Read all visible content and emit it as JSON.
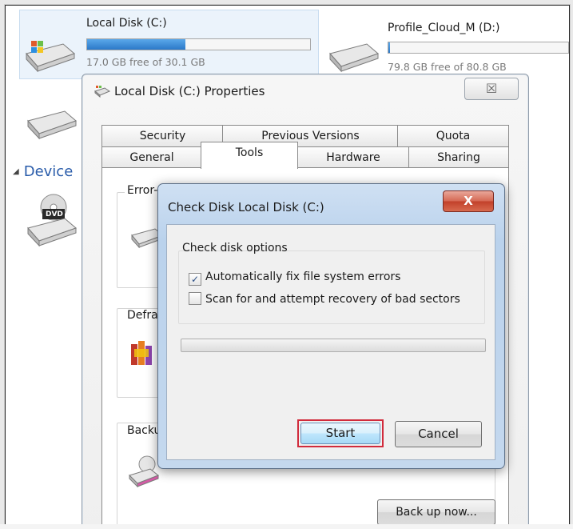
{
  "explorer": {
    "drives": [
      {
        "name": "Local Disk (C:)",
        "free_text": "17.0 GB free of 30.1 GB",
        "used_fraction": 0.44,
        "icon": "hard-drive-windows-icon"
      },
      {
        "name": "Profile_Cloud_M (D:)",
        "free_text": "79.8 GB free of 80.8 GB",
        "used_fraction": 0.01,
        "icon": "hard-drive-icon"
      }
    ],
    "devices_label": "Device",
    "dvd_label": "DVD"
  },
  "properties": {
    "title": "Local Disk (C:) Properties",
    "close_glyph": "☒",
    "tabs_row1": [
      "Security",
      "Previous Versions",
      "Quota"
    ],
    "tabs_row2": [
      "General",
      "Tools",
      "Hardware",
      "Sharing"
    ],
    "active_tab": "Tools",
    "sections": {
      "error_checking": "Error-checking",
      "defrag": "Defrag",
      "backup": "Backu"
    },
    "backup_button": "Back up now..."
  },
  "check_disk": {
    "title": "Check Disk Local Disk (C:)",
    "close_glyph": "X",
    "options_label": "Check disk options",
    "option1": {
      "label": "Automatically fix file system errors",
      "checked": true,
      "check_glyph": "✓"
    },
    "option2": {
      "label": "Scan for and attempt recovery of bad sectors",
      "checked": false,
      "check_glyph": ""
    },
    "progress": 0,
    "start_label": "Start",
    "cancel_label": "Cancel",
    "highlight_color": "#d12b3c"
  }
}
